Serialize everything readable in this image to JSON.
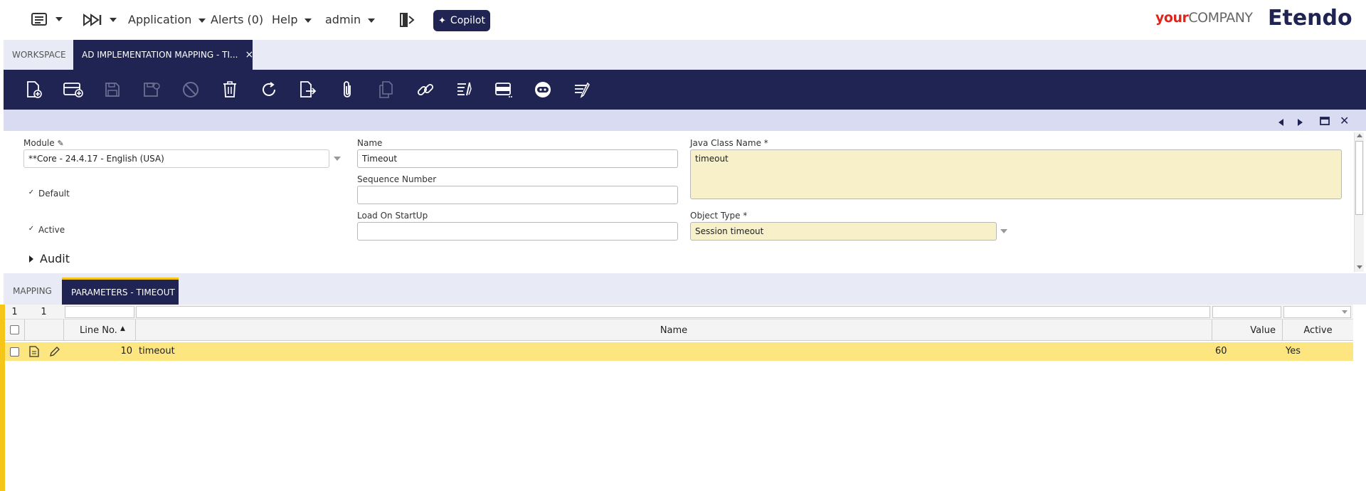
{
  "topbar": {
    "nav": {
      "application": "Application",
      "alerts": "Alerts (0)",
      "help": "Help",
      "user": "admin"
    },
    "copilot_label": "Copilot",
    "company_logo": {
      "bold": "your",
      "rest": "COMPANY"
    },
    "brand": "Etendo"
  },
  "tabs": [
    {
      "label": "WORKSPACE"
    },
    {
      "label": "AD IMPLEMENTATION MAPPING - TI...",
      "close": "×"
    }
  ],
  "toolbar": {
    "buttons": [
      "new-document",
      "new-row",
      "save",
      "save-close",
      "undo",
      "delete",
      "refresh",
      "export",
      "attach",
      "clone",
      "link",
      "audit",
      "grid-view",
      "copilot-bot",
      "notes"
    ]
  },
  "form": {
    "module": {
      "label": "Module",
      "value": "**Core - 24.4.17 - English (USA)"
    },
    "name": {
      "label": "Name",
      "value": "Timeout"
    },
    "java_class": {
      "label": "Java Class Name *",
      "value": "timeout"
    },
    "default": {
      "label": "Default",
      "check": "✓"
    },
    "sequence": {
      "label": "Sequence Number",
      "value": ""
    },
    "active": {
      "label": "Active",
      "check": "✓"
    },
    "load_startup": {
      "label": "Load On StartUp",
      "value": ""
    },
    "object_type": {
      "label": "Object Type *",
      "value": "Session timeout"
    },
    "audit": "Audit"
  },
  "subtabs": [
    {
      "label": "MAPPING"
    },
    {
      "label": "PARAMETERS - TIMEOUT"
    }
  ],
  "grid": {
    "counts": [
      "1",
      "1"
    ],
    "columns": {
      "line": "Line No.",
      "name": "Name",
      "value": "Value",
      "active": "Active"
    },
    "rows": [
      {
        "line": "10",
        "name": "timeout",
        "value": "60",
        "active": "Yes"
      }
    ]
  },
  "colors": {
    "navy": "#202452",
    "accent": "#f5c518",
    "selected_row": "#fde57f",
    "required": "#f8f0c8"
  }
}
